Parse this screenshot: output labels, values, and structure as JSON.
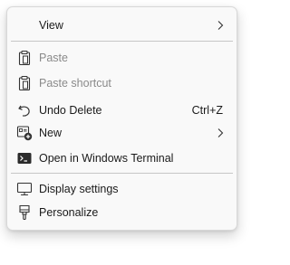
{
  "menu": {
    "view": {
      "label": "View",
      "icon": "none",
      "has_submenu": true
    },
    "paste": {
      "label": "Paste",
      "icon": "clipboard-icon",
      "disabled": true
    },
    "paste_shortcut": {
      "label": "Paste shortcut",
      "icon": "clipboard-icon",
      "disabled": true
    },
    "undo_delete": {
      "label": "Undo Delete",
      "shortcut": "Ctrl+Z",
      "icon": "undo-icon"
    },
    "new": {
      "label": "New",
      "icon": "new-item-icon",
      "has_submenu": true
    },
    "open_terminal": {
      "label": "Open in Windows Terminal",
      "icon": "terminal-icon"
    },
    "display_settings": {
      "label": "Display settings",
      "icon": "monitor-icon"
    },
    "personalize": {
      "label": "Personalize",
      "icon": "paintbrush-icon"
    }
  },
  "colors": {
    "menu_background": "#f9f9f9",
    "text": "#1a1a1a",
    "disabled_text": "#8a8a8a",
    "separator": "#c6c6c6"
  }
}
